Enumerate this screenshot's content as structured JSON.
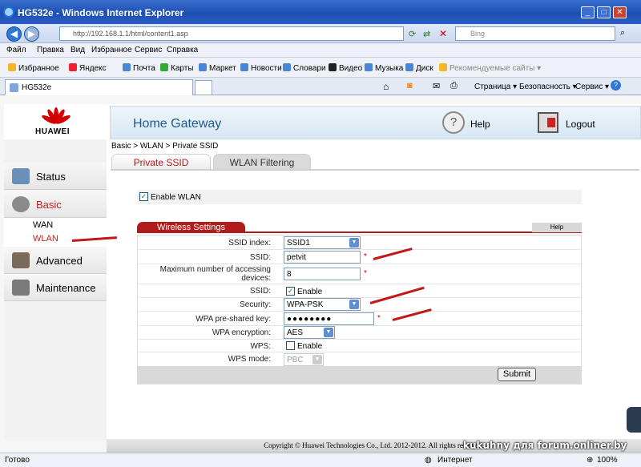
{
  "window": {
    "title": "HG532e - Windows Internet Explorer"
  },
  "address": {
    "url": "http://192.168.1.1/html/content1.asp",
    "search_placeholder": "Bing"
  },
  "menu": [
    "Файл",
    "Правка",
    "Вид",
    "Избранное",
    "Сервис",
    "Справка"
  ],
  "favorites": {
    "label": "Избранное",
    "items": [
      "Яндекс",
      "Почта",
      "Карты",
      "Маркет",
      "Новости",
      "Словари",
      "Видео",
      "Музыка",
      "Диск",
      "Рекомендуемые сайты ▾"
    ]
  },
  "tab": {
    "label": "HG532e"
  },
  "commandbar": [
    "Страница ▾",
    "Безопасность ▾",
    "Сервис ▾"
  ],
  "brand": {
    "name": "HUAWEI",
    "brand_color": "#cc0000"
  },
  "header": {
    "title": "Home Gateway",
    "help": "Help",
    "logout": "Logout"
  },
  "sidebar": {
    "status": "Status",
    "basic": "Basic",
    "wan": "WAN",
    "wlan": "WLAN",
    "advanced": "Advanced",
    "maintenance": "Maintenance"
  },
  "breadcrumb": "Basic > WLAN > Private SSID",
  "tabs": {
    "private_ssid": "Private SSID",
    "wlan_filtering": "WLAN Filtering"
  },
  "enable_wlan": {
    "label": "Enable WLAN",
    "checked": true
  },
  "section": {
    "title": "Wireless Settings",
    "help": "Help"
  },
  "form": {
    "ssid_index": {
      "label": "SSID index:",
      "value": "SSID1"
    },
    "ssid": {
      "label": "SSID:",
      "value": "petvit",
      "required": "*"
    },
    "max_devices": {
      "label": "Maximum number of accessing devices:",
      "value": "8",
      "required": "*"
    },
    "ssid_enable": {
      "label": "SSID:",
      "option": "Enable",
      "checked": true
    },
    "security": {
      "label": "Security:",
      "value": "WPA-PSK"
    },
    "wpa_key": {
      "label": "WPA pre-shared key:",
      "value": "●●●●●●●●",
      "required": "*"
    },
    "wpa_encryption": {
      "label": "WPA encryption:",
      "value": "AES"
    },
    "wps": {
      "label": "WPS:",
      "option": "Enable",
      "checked": false
    },
    "wps_mode": {
      "label": "WPS mode:",
      "value": "PBC"
    }
  },
  "submit": "Submit",
  "footer": "Copyright © Huawei Technologies Co., Ltd. 2012-2012. All rights reserved.",
  "statusbar": {
    "status": "Готово",
    "zone": "Интернет",
    "zoom": "100%"
  },
  "watermark": "kukuhny для forum.onliner.by"
}
